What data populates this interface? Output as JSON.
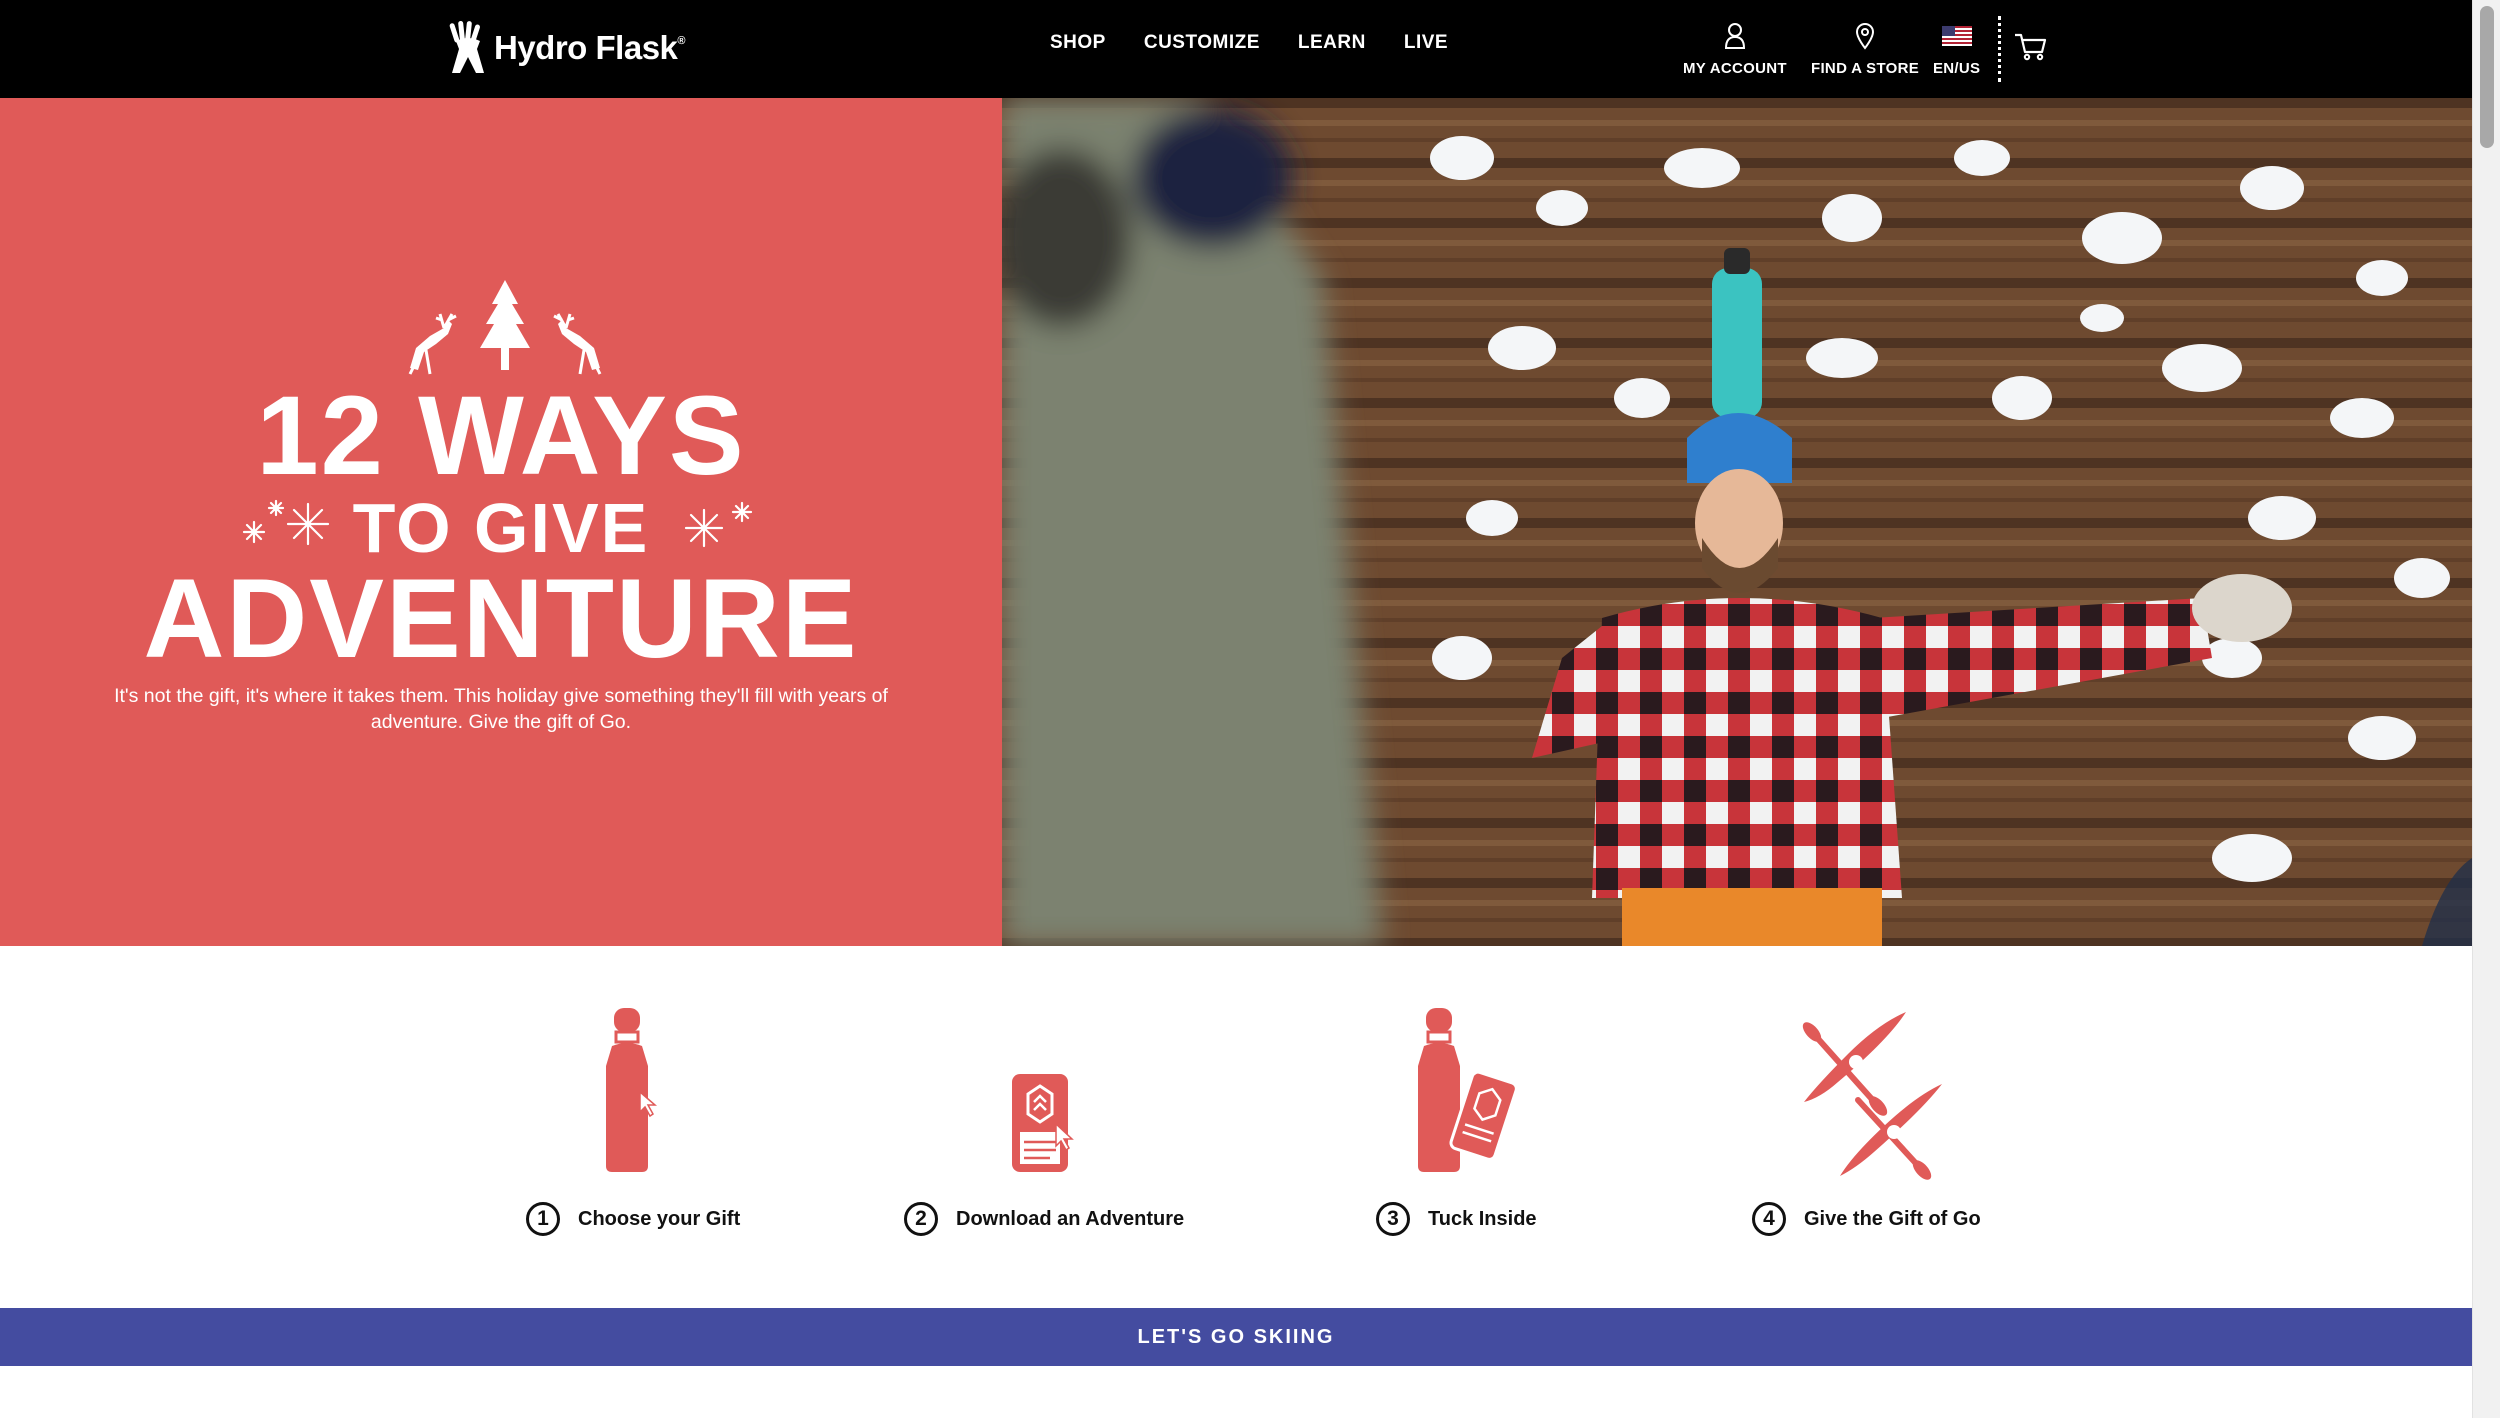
{
  "header": {
    "brand": "Hydro Flask",
    "nav": [
      "SHOP",
      "CUSTOMIZE",
      "LEARN",
      "LIVE"
    ],
    "account_label": "MY ACCOUNT",
    "store_label": "FIND A STORE",
    "locale_label": "EN/US",
    "icons": [
      "user-icon",
      "map-pin-icon",
      "us-flag-icon",
      "cart-icon"
    ]
  },
  "hero": {
    "line1": "12 WAYS",
    "line2": "TO GIVE",
    "line3": "ADVENTURE",
    "subtitle": "It's not the gift, it's where it takes them. This holiday give something they'll fill with years of adventure. Give the gift of Go.",
    "background_color": "#e05a58"
  },
  "steps": [
    {
      "number": "1",
      "label": "Choose your Gift",
      "icon": "bottle-icon"
    },
    {
      "number": "2",
      "label": "Download an Adventure",
      "icon": "phone-download-icon"
    },
    {
      "number": "3",
      "label": "Tuck Inside",
      "icon": "bottle-with-card-icon"
    },
    {
      "number": "4",
      "label": "Give the Gift of Go",
      "icon": "kayaks-icon"
    }
  ],
  "cta": {
    "label": "LET'S GO SKIING",
    "background_color": "#444ca0"
  },
  "colors": {
    "accent": "#e05a58",
    "header": "#000000"
  }
}
